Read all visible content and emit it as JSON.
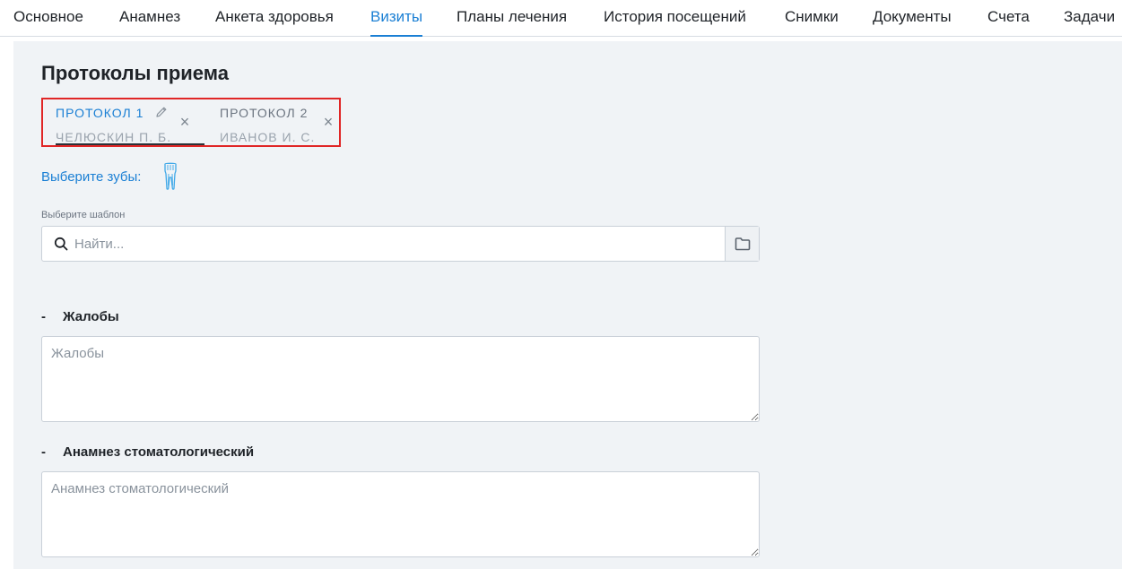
{
  "nav": {
    "tabs": [
      {
        "label": "Основное"
      },
      {
        "label": "Анамнез"
      },
      {
        "label": "Анкета здоровья"
      },
      {
        "label": "Визиты"
      },
      {
        "label": "Планы лечения"
      },
      {
        "label": "История посещений"
      },
      {
        "label": "Снимки"
      },
      {
        "label": "Документы"
      },
      {
        "label": "Счета"
      },
      {
        "label": "Задачи"
      }
    ],
    "active_tab": "Визиты"
  },
  "page": {
    "title": "Протоколы приема"
  },
  "protocols": [
    {
      "name": "ПРОТОКОЛ 1",
      "doctor": "ЧЕЛЮСКИН П. Б.",
      "close": "×",
      "active": true
    },
    {
      "name": "ПРОТОКОЛ 2",
      "doctor": "ИВАНОВ И. С.",
      "close": "×",
      "active": false
    }
  ],
  "teeth": {
    "label": "Выберите зубы:"
  },
  "template": {
    "label": "Выберите шаблон",
    "search_placeholder": "Найти..."
  },
  "sections": [
    {
      "dash": "-",
      "title": "Жалобы",
      "placeholder": "Жалобы"
    },
    {
      "dash": "-",
      "title": "Анамнез стоматологический",
      "placeholder": "Анамнез стоматологический"
    }
  ],
  "colors": {
    "accent": "#1a7fd4",
    "highlight": "#e02626",
    "panel_bg": "#f0f3f6"
  }
}
